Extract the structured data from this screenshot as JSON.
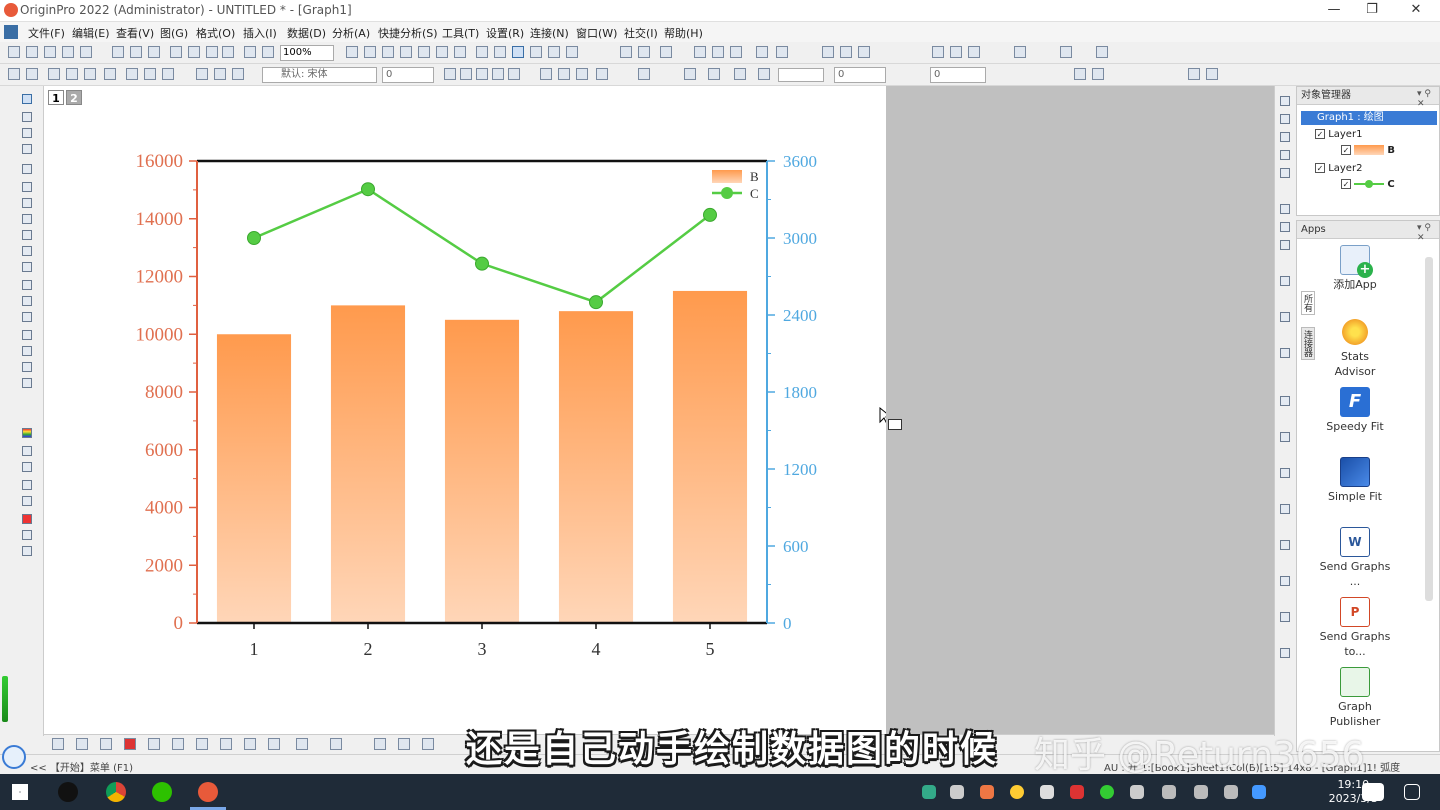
{
  "window": {
    "title": "OriginPro 2022 (Administrator) - UNTITLED * - [Graph1]",
    "buttons": [
      "—",
      "❐",
      "✕"
    ]
  },
  "menu": [
    "文件(F)",
    "编辑(E)",
    "查看(V)",
    "图(G)",
    "格式(O)",
    "插入(I)",
    "数据(D)",
    "分析(A)",
    "快捷分析(S)",
    "工具(T)",
    "设置(R)",
    "连接(N)",
    "窗口(W)",
    "社交(I)",
    "帮助(H)"
  ],
  "toolbar": {
    "zoom": "100%",
    "font": "默认: 宋体",
    "font_size": "0",
    "line_value": "0"
  },
  "layer_tabs": [
    "1",
    "2"
  ],
  "object_manager": {
    "title": "对象管理器",
    "graph": "Graph1 : 绘图",
    "layer1": "Layer1",
    "plot_b": "B",
    "layer2": "Layer2",
    "plot_c": "C"
  },
  "apps": {
    "title": "Apps",
    "side_tabs": [
      "所有",
      "连接器"
    ],
    "items": [
      {
        "label": "添加App",
        "icon": "add-app-icon"
      },
      {
        "label": "Stats Advisor",
        "icon": "stats-advisor-icon"
      },
      {
        "label": "Speedy Fit",
        "icon": "speedy-fit-icon"
      },
      {
        "label": "Simple Fit",
        "icon": "simple-fit-icon"
      },
      {
        "label": "Send Graphs ...",
        "icon": "send-word-icon"
      },
      {
        "label": "Send Graphs to...",
        "icon": "send-ppt-icon"
      },
      {
        "label": "Graph Publisher",
        "icon": "graph-publisher-icon"
      }
    ]
  },
  "statusbar": {
    "left": "<< 【开始】菜单 (F1)",
    "right": "AU : 开  1:[Book1]Sheet1!Col(B)[1:5]  14x8 - [Graph1]1!  弧度"
  },
  "taskbar": {
    "time": "19:10",
    "date": "2023/3/3"
  },
  "overlay": {
    "subtitle": "还是自己动手绘制数据图的时候",
    "watermark": "知乎 @Return3656"
  },
  "colors": {
    "bar_top": "#ff9a4d",
    "bar_bottom": "#ffd6b8",
    "line": "#55cc44",
    "left_axis": "#e06040",
    "right_axis": "#4fa8e0"
  },
  "chart_data": {
    "type": "bar",
    "categories": [
      "1",
      "2",
      "3",
      "4",
      "5"
    ],
    "series": [
      {
        "name": "B",
        "type": "bar",
        "axis": "left",
        "values": [
          10000,
          11000,
          10500,
          10800,
          11500
        ]
      },
      {
        "name": "C",
        "type": "line",
        "axis": "right",
        "values": [
          3000,
          3380,
          2800,
          2500,
          3180
        ]
      }
    ],
    "ylim_left": [
      0,
      16000
    ],
    "yticks_left": [
      0,
      2000,
      4000,
      6000,
      8000,
      10000,
      12000,
      14000,
      16000
    ],
    "ylim_right": [
      0,
      3600
    ],
    "yticks_right": [
      0,
      600,
      1200,
      1800,
      2400,
      3000,
      3600
    ],
    "legend": "top-right",
    "grid": false
  }
}
